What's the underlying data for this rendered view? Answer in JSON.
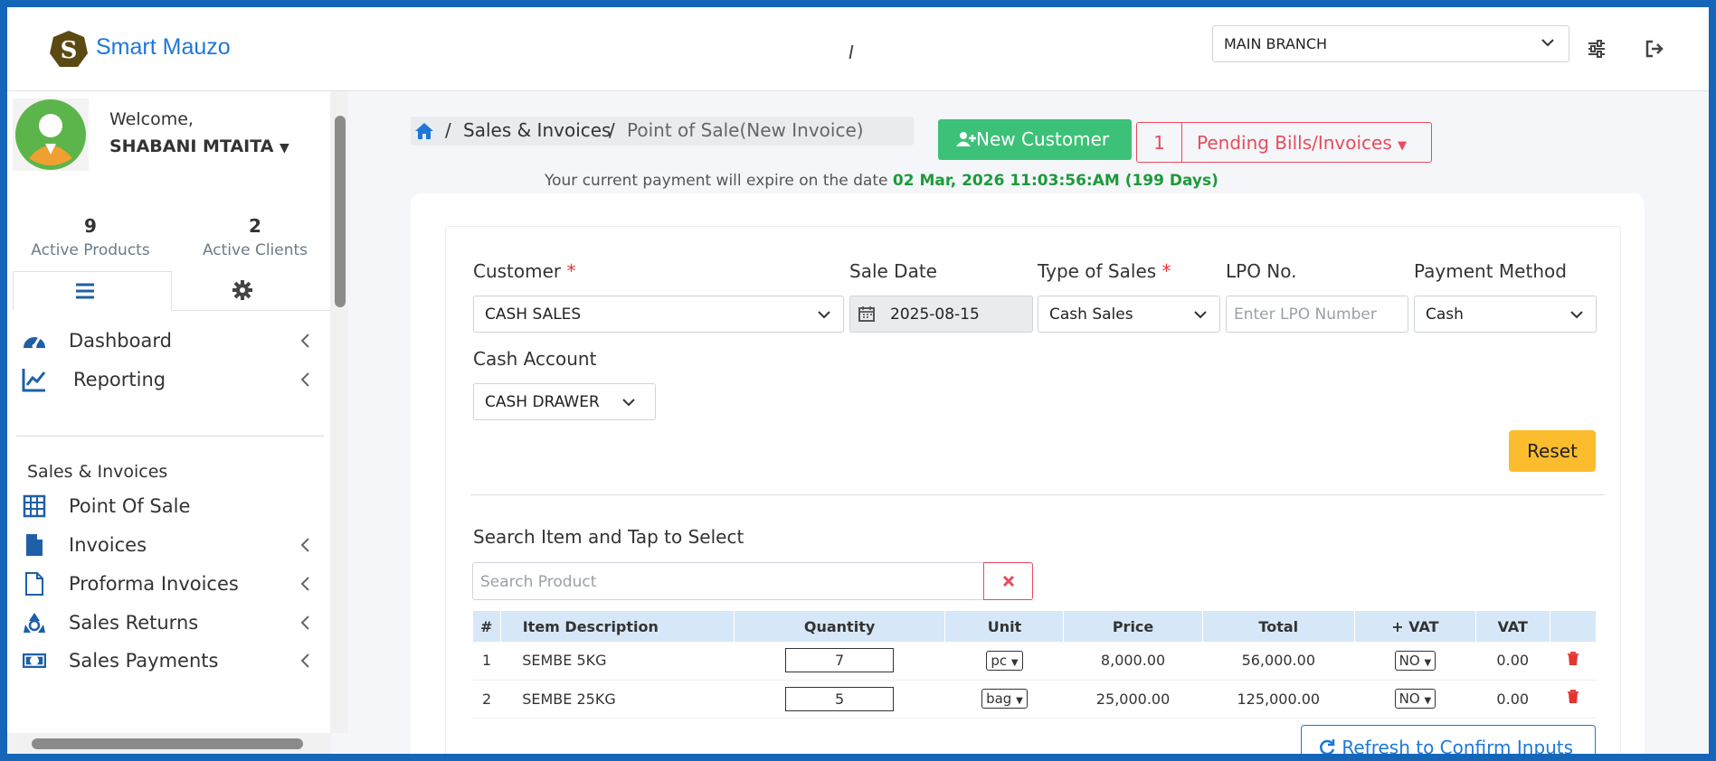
{
  "app": {
    "brand": "Smart Mauzo"
  },
  "topbar": {
    "cursor_glyph": "I",
    "branch_select": "MAIN BRANCH",
    "icons": [
      "sliders-icon",
      "logout-icon"
    ]
  },
  "sidebar": {
    "welcome": "Welcome,",
    "username": "SHABANI MTAITA",
    "stats": [
      {
        "value": "9",
        "label": "Active Products"
      },
      {
        "value": "2",
        "label": "Active Clients"
      }
    ],
    "tabs": [
      {
        "icon": "menu-icon"
      },
      {
        "icon": "gear-icon"
      }
    ],
    "menu": [
      {
        "label": "Dashboard",
        "icon": "dashboard-icon",
        "has_children": true
      },
      {
        "label": "Reporting",
        "icon": "chart-line-icon",
        "has_children": true
      }
    ],
    "section_label": "Sales & Invoices",
    "section_menu": [
      {
        "label": "Point Of Sale",
        "icon": "calculator-icon",
        "has_children": false
      },
      {
        "label": "Invoices",
        "icon": "file-icon",
        "has_children": true
      },
      {
        "label": "Proforma Invoices",
        "icon": "file-outline-icon",
        "has_children": true
      },
      {
        "label": "Sales Returns",
        "icon": "recycle-icon",
        "has_children": true
      },
      {
        "label": "Sales Payments",
        "icon": "money-icon",
        "has_children": true
      }
    ]
  },
  "breadcrumb": {
    "items": [
      "Sales & Invoices",
      "Point of Sale(New Invoice)"
    ],
    "separator": "/"
  },
  "actions": {
    "new_customer": "New Customer",
    "pending_count": "1",
    "pending_label": "Pending Bills/Invoices"
  },
  "expiry": {
    "text": "Your current payment will expire on the date",
    "date": "02 Mar, 2026 11:03:56:AM (199 Days)"
  },
  "form": {
    "customer": {
      "label": "Customer",
      "required": "*",
      "value": "CASH SALES"
    },
    "sale_date": {
      "label": "Sale Date",
      "value": "2025-08-15"
    },
    "type_of_sales": {
      "label": "Type of Sales",
      "required": "*",
      "value": "Cash Sales"
    },
    "lpo": {
      "label": "LPO No.",
      "placeholder": "Enter LPO Number"
    },
    "payment_method": {
      "label": "Payment Method",
      "value": "Cash"
    },
    "cash_account": {
      "label": "Cash Account",
      "value": "CASH DRAWER"
    },
    "reset": "Reset"
  },
  "search": {
    "label": "Search Item and Tap to Select",
    "placeholder": "Search Product"
  },
  "table": {
    "headers": [
      "#",
      "Item Description",
      "Quantity",
      "Unit",
      "Price",
      "Total",
      "+ VAT",
      "VAT"
    ],
    "rows": [
      {
        "no": "1",
        "item": "SEMBE 5KG",
        "qty": "7",
        "unit": "pc",
        "price": "8,000.00",
        "total": "56,000.00",
        "vat_option": "NO",
        "vat": "0.00"
      },
      {
        "no": "2",
        "item": "SEMBE 25KG",
        "qty": "5",
        "unit": "bag",
        "price": "25,000.00",
        "total": "125,000.00",
        "vat_option": "NO",
        "vat": "0.00"
      }
    ]
  },
  "refresh_button": "Refresh to Confirm Inputs",
  "colors": {
    "accent": "#1e78d8",
    "success": "#3cc178",
    "danger": "#e74c5c",
    "warning": "#fbbd2e",
    "frame": "#1565b8"
  }
}
